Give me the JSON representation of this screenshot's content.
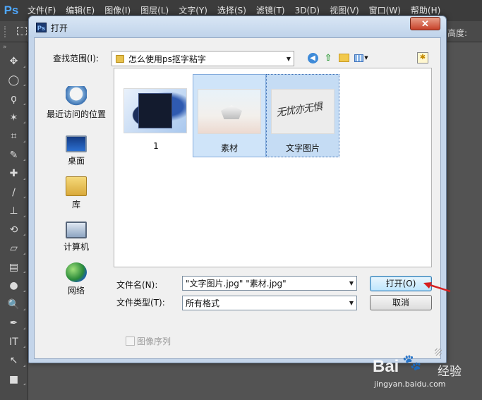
{
  "app": {
    "logo": "Ps",
    "menu": [
      "文件(F)",
      "编辑(E)",
      "图像(I)",
      "图层(L)",
      "文字(Y)",
      "选择(S)",
      "滤镜(T)",
      "3D(D)",
      "视图(V)",
      "窗口(W)",
      "帮助(H)"
    ],
    "options_right_label": "高度:",
    "toolbar_header": "»",
    "tools": [
      "move-tool",
      "marquee-tool",
      "lasso-tool",
      "magic-wand-tool",
      "crop-tool",
      "eyedropper-tool",
      "healing-tool",
      "brush-tool",
      "clone-stamp-tool",
      "history-brush-tool",
      "eraser-tool",
      "gradient-tool",
      "blur-tool",
      "dodge-tool",
      "pen-tool",
      "type-tool",
      "path-selection-tool",
      "rectangle-tool"
    ],
    "tool_glyphs": [
      "✥",
      "◯",
      "ϙ",
      "✶",
      "⌗",
      "✎",
      "✚",
      "∕",
      "⊥",
      "⟲",
      "▱",
      "▤",
      "●",
      "🔍",
      "✒",
      "IT",
      "↖",
      "■"
    ]
  },
  "dialog": {
    "title": "打开",
    "title_icon": "Ps",
    "close_label": "✕",
    "lookin_label": "查找范围(I):",
    "lookin_value": "怎么使用ps抠字粘字",
    "nav": {
      "back_icon": "back-icon",
      "back_glyph": "◀",
      "up_icon": "up-folder-icon",
      "up_glyph": "⇧",
      "new_folder_icon": "new-folder-icon",
      "view_menu_icon": "view-menu-icon",
      "favorites_glyph": "✱"
    },
    "places": [
      {
        "label": "最近访问的位置",
        "icon": "recent-places-icon"
      },
      {
        "label": "桌面",
        "icon": "desktop-icon"
      },
      {
        "label": "库",
        "icon": "libraries-icon"
      },
      {
        "label": "计算机",
        "icon": "computer-icon"
      },
      {
        "label": "网络",
        "icon": "network-icon"
      }
    ],
    "files": [
      {
        "name": "1",
        "state": "normal"
      },
      {
        "name": "素材",
        "state": "selected"
      },
      {
        "name": "文字图片",
        "state": "focused"
      }
    ],
    "thumbnail_script_text": "无忧亦无惧",
    "filename_label": "文件名(N):",
    "filename_value": "\"文字图片.jpg\" \"素材.jpg\"",
    "filetype_label": "文件类型(T):",
    "filetype_value": "所有格式",
    "open_button": "打开(O)",
    "cancel_button": "取消",
    "image_sequence_label": "图像序列",
    "image_sequence_checked": false
  },
  "watermark": {
    "logo": "Bai",
    "paw": "🐾",
    "experience": "经验",
    "url": "jingyan.baidu.com"
  },
  "colors": {
    "accent_annotation": "#d62020",
    "selection": "#cfe4f9"
  }
}
